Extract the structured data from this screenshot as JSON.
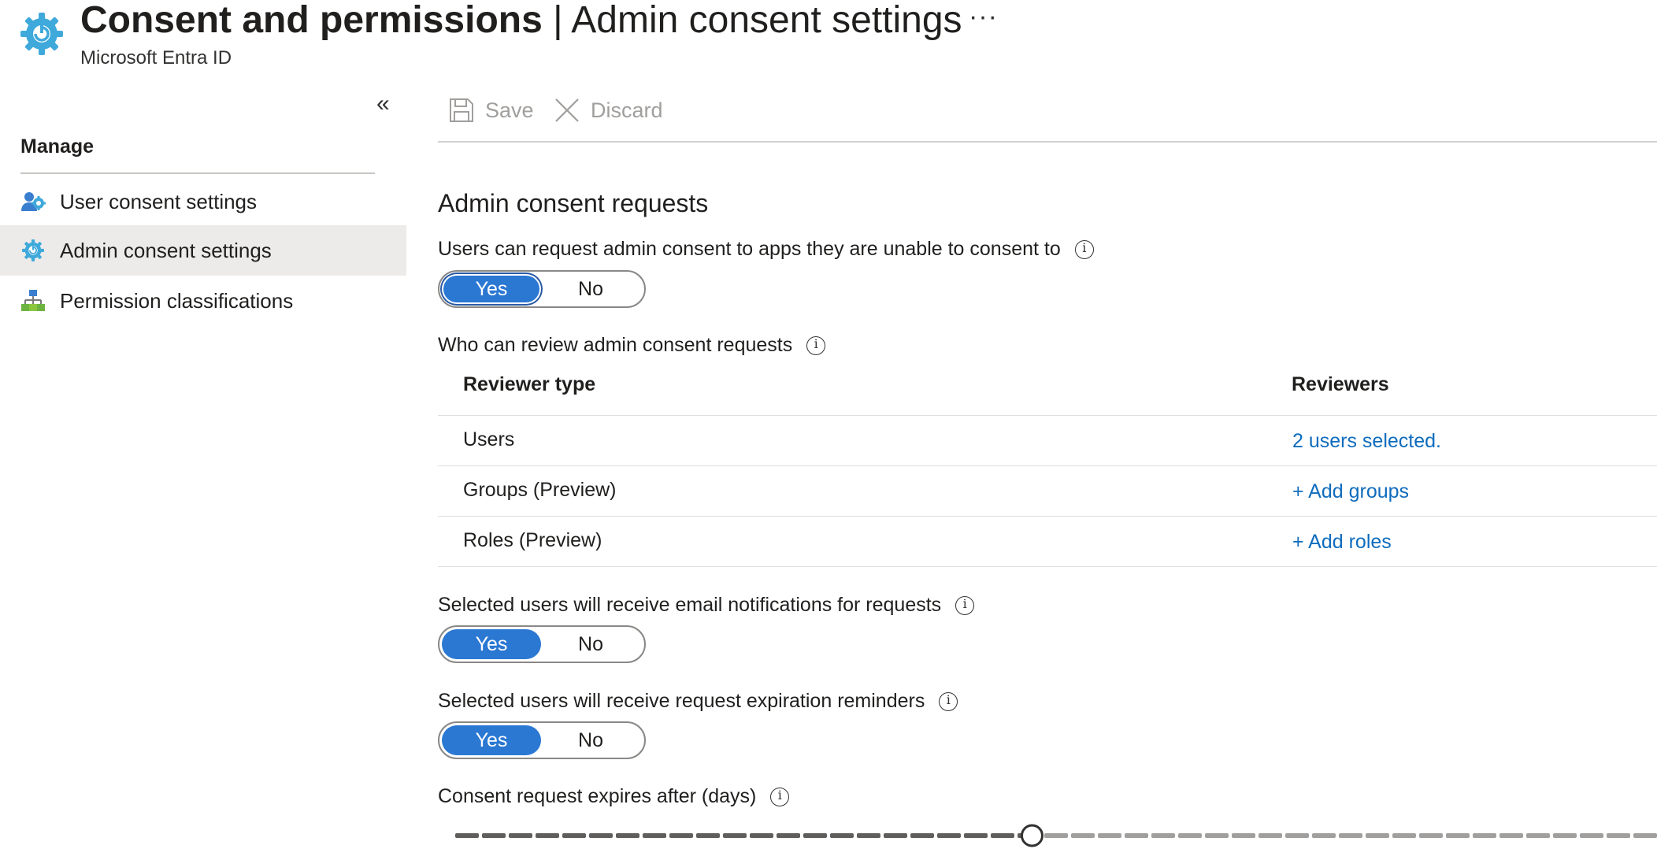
{
  "header": {
    "title_bold": "Consent and permissions",
    "title_rest": " | Admin consent settings",
    "subtitle": "Microsoft Entra ID",
    "more_label": "···",
    "icon": "gear-icon"
  },
  "sidebar": {
    "collapse_label": "«",
    "manage_heading": "Manage",
    "items": [
      {
        "label": "User consent settings",
        "icon": "user-settings-icon",
        "selected": false
      },
      {
        "label": "Admin consent settings",
        "icon": "gear-icon",
        "selected": true
      },
      {
        "label": "Permission classifications",
        "icon": "hierarchy-icon",
        "selected": false
      }
    ]
  },
  "toolbar": {
    "save_label": "Save",
    "discard_label": "Discard"
  },
  "main": {
    "section_title": "Admin consent requests",
    "request_consent": {
      "label": "Users can request admin consent to apps they are unable to consent to",
      "yes": "Yes",
      "no": "No",
      "value": "Yes"
    },
    "reviewers_label": "Who can review admin consent requests",
    "table": {
      "headers": [
        "Reviewer type",
        "Reviewers"
      ],
      "rows": [
        {
          "type": "Users",
          "reviewers": "2 users selected."
        },
        {
          "type": "Groups (Preview)",
          "reviewers": "+ Add groups"
        },
        {
          "type": "Roles (Preview)",
          "reviewers": "+ Add roles"
        }
      ]
    },
    "email_notifications": {
      "label": "Selected users will receive email notifications for requests",
      "yes": "Yes",
      "no": "No",
      "value": "Yes"
    },
    "expiration_reminders": {
      "label": "Selected users will receive request expiration reminders",
      "yes": "Yes",
      "no": "No",
      "value": "Yes"
    },
    "expires_label": "Consent request expires after (days)",
    "slider": {
      "fraction": 0.48
    }
  },
  "colors": {
    "accent": "#2b78d3",
    "link": "#0f6cbd",
    "selected_bg": "#edebe9",
    "icon_blue": "#3fa9db"
  }
}
